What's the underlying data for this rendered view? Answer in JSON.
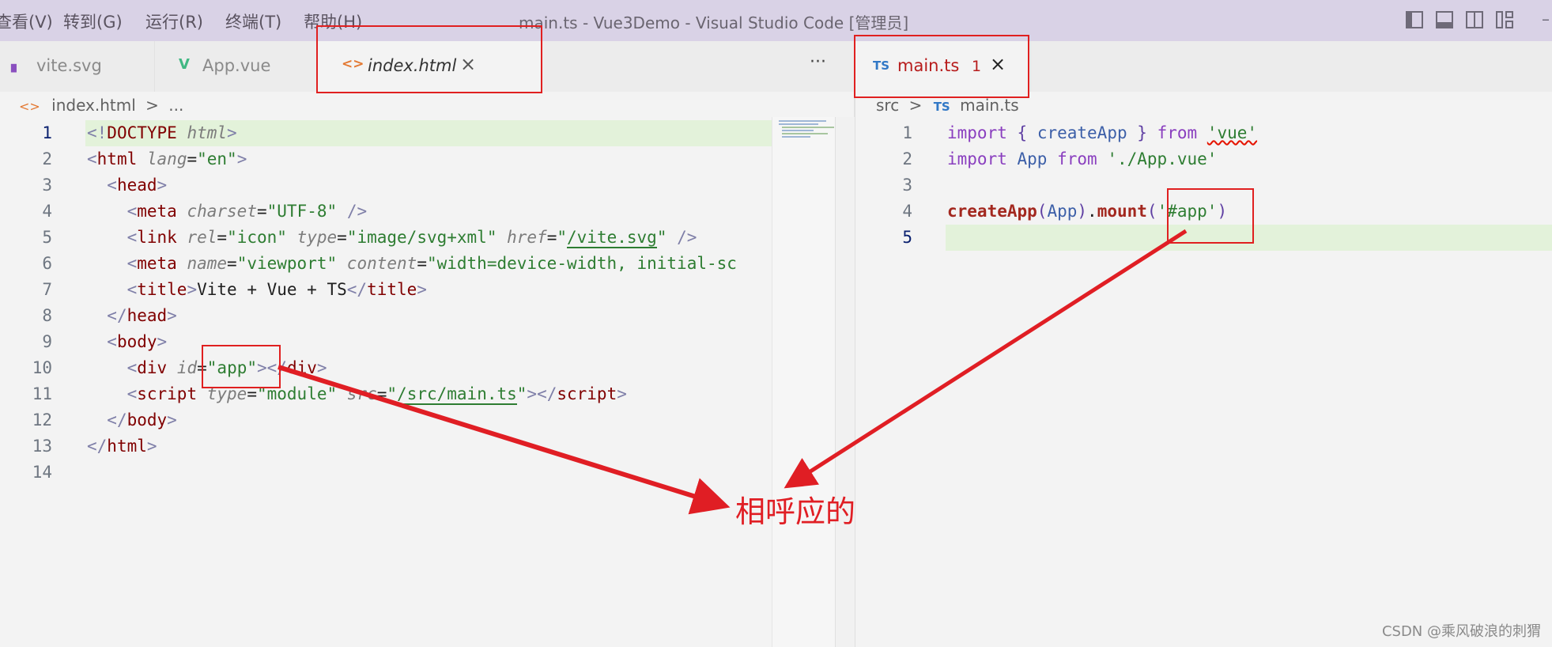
{
  "menubar": {
    "items": [
      "查看(V)",
      "转到(G)",
      "运行(R)",
      "终端(T)",
      "帮助(H)"
    ],
    "window_title": "main.ts - Vue3Demo - Visual Studio Code [管理员]"
  },
  "left_tabs": [
    {
      "icon": "▖",
      "label": "vite.svg"
    },
    {
      "icon": "V",
      "label": "App.vue"
    },
    {
      "icon": "<>",
      "label": "index.html",
      "close": "×"
    }
  ],
  "left_more": "···",
  "left_breadcrumb": {
    "icon": "<>",
    "file": "index.html",
    "sep": ">",
    "rest": "..."
  },
  "html_lines": [
    {
      "n": "1",
      "parts": [
        [
          "t-br",
          "<!"
        ],
        [
          "t-tag",
          "DOCTYPE"
        ],
        [
          "t-txt",
          " "
        ],
        [
          "t-attr",
          "html"
        ],
        [
          "t-br",
          ">"
        ]
      ]
    },
    {
      "n": "2",
      "parts": [
        [
          "t-br",
          "<"
        ],
        [
          "t-tag",
          "html"
        ],
        [
          "t-txt",
          " "
        ],
        [
          "t-attr",
          "lang"
        ],
        [
          "t-txt",
          "="
        ],
        [
          "t-str",
          "\"en\""
        ],
        [
          "t-br",
          ">"
        ]
      ]
    },
    {
      "n": "3",
      "parts": [
        [
          "t-txt",
          "  "
        ],
        [
          "t-br",
          "<"
        ],
        [
          "t-tag",
          "head"
        ],
        [
          "t-br",
          ">"
        ]
      ]
    },
    {
      "n": "4",
      "parts": [
        [
          "t-txt",
          "    "
        ],
        [
          "t-br",
          "<"
        ],
        [
          "t-tag",
          "meta"
        ],
        [
          "t-txt",
          " "
        ],
        [
          "t-attr",
          "charset"
        ],
        [
          "t-txt",
          "="
        ],
        [
          "t-str",
          "\"UTF-8\""
        ],
        [
          "t-txt",
          " "
        ],
        [
          "t-br",
          "/>"
        ]
      ]
    },
    {
      "n": "5",
      "parts": [
        [
          "t-txt",
          "    "
        ],
        [
          "t-br",
          "<"
        ],
        [
          "t-tag",
          "link"
        ],
        [
          "t-txt",
          " "
        ],
        [
          "t-attr",
          "rel"
        ],
        [
          "t-txt",
          "="
        ],
        [
          "t-str",
          "\"icon\""
        ],
        [
          "t-txt",
          " "
        ],
        [
          "t-attr",
          "type"
        ],
        [
          "t-txt",
          "="
        ],
        [
          "t-str",
          "\"image/svg+xml\""
        ],
        [
          "t-txt",
          " "
        ],
        [
          "t-attr",
          "href"
        ],
        [
          "t-txt",
          "="
        ],
        [
          "t-str",
          "\""
        ],
        [
          "t-str u",
          "/vite.svg"
        ],
        [
          "t-str",
          "\""
        ],
        [
          "t-txt",
          " "
        ],
        [
          "t-br",
          "/>"
        ]
      ]
    },
    {
      "n": "6",
      "parts": [
        [
          "t-txt",
          "    "
        ],
        [
          "t-br",
          "<"
        ],
        [
          "t-tag",
          "meta"
        ],
        [
          "t-txt",
          " "
        ],
        [
          "t-attr",
          "name"
        ],
        [
          "t-txt",
          "="
        ],
        [
          "t-str",
          "\"viewport\""
        ],
        [
          "t-txt",
          " "
        ],
        [
          "t-attr",
          "content"
        ],
        [
          "t-txt",
          "="
        ],
        [
          "t-str",
          "\"width=device-width, initial-sc"
        ]
      ]
    },
    {
      "n": "7",
      "parts": [
        [
          "t-txt",
          "    "
        ],
        [
          "t-br",
          "<"
        ],
        [
          "t-tag",
          "title"
        ],
        [
          "t-br",
          ">"
        ],
        [
          "t-txt",
          "Vite + Vue + TS"
        ],
        [
          "t-br",
          "</"
        ],
        [
          "t-tag",
          "title"
        ],
        [
          "t-br",
          ">"
        ]
      ]
    },
    {
      "n": "8",
      "parts": [
        [
          "t-txt",
          "  "
        ],
        [
          "t-br",
          "</"
        ],
        [
          "t-tag",
          "head"
        ],
        [
          "t-br",
          ">"
        ]
      ]
    },
    {
      "n": "9",
      "parts": [
        [
          "t-txt",
          "  "
        ],
        [
          "t-br",
          "<"
        ],
        [
          "t-tag",
          "body"
        ],
        [
          "t-br",
          ">"
        ]
      ]
    },
    {
      "n": "10",
      "parts": [
        [
          "t-txt",
          "    "
        ],
        [
          "t-br",
          "<"
        ],
        [
          "t-tag",
          "div"
        ],
        [
          "t-txt",
          " "
        ],
        [
          "t-attr",
          "id"
        ],
        [
          "t-txt",
          "="
        ],
        [
          "t-str",
          "\"app\""
        ],
        [
          "t-br",
          ">"
        ],
        [
          "t-br",
          "</"
        ],
        [
          "t-tag",
          "div"
        ],
        [
          "t-br",
          ">"
        ]
      ]
    },
    {
      "n": "11",
      "parts": [
        [
          "t-txt",
          "    "
        ],
        [
          "t-br",
          "<"
        ],
        [
          "t-tag",
          "script"
        ],
        [
          "t-txt",
          " "
        ],
        [
          "t-attr",
          "type"
        ],
        [
          "t-txt",
          "="
        ],
        [
          "t-str",
          "\"module\""
        ],
        [
          "t-txt",
          " "
        ],
        [
          "t-attr",
          "src"
        ],
        [
          "t-txt",
          "="
        ],
        [
          "t-str",
          "\""
        ],
        [
          "t-str u",
          "/src/main.ts"
        ],
        [
          "t-str",
          "\""
        ],
        [
          "t-br",
          "></"
        ],
        [
          "t-tag",
          "script"
        ],
        [
          "t-br",
          ">"
        ]
      ]
    },
    {
      "n": "12",
      "parts": [
        [
          "t-txt",
          "  "
        ],
        [
          "t-br",
          "</"
        ],
        [
          "t-tag",
          "body"
        ],
        [
          "t-br",
          ">"
        ]
      ]
    },
    {
      "n": "13",
      "parts": [
        [
          "t-br",
          "</"
        ],
        [
          "t-tag",
          "html"
        ],
        [
          "t-br",
          ">"
        ]
      ]
    },
    {
      "n": "14",
      "parts": []
    }
  ],
  "right_tab": {
    "icon": "TS",
    "label": "main.ts",
    "badge": "1",
    "close": "×"
  },
  "right_breadcrumb": {
    "folder": "src",
    "sep": ">",
    "icon": "TS",
    "file": "main.ts"
  },
  "ts_lines": [
    {
      "n": "1",
      "parts": [
        [
          "t-kw",
          "import"
        ],
        [
          "t-txt",
          " "
        ],
        [
          "t-punc",
          "{"
        ],
        [
          "t-txt",
          " "
        ],
        [
          "t-id",
          "createApp"
        ],
        [
          "t-txt",
          " "
        ],
        [
          "t-punc",
          "}"
        ],
        [
          "t-txt",
          " "
        ],
        [
          "t-kw",
          "from"
        ],
        [
          "t-txt",
          " "
        ],
        [
          "t-str sq",
          "'vue'"
        ]
      ]
    },
    {
      "n": "2",
      "parts": [
        [
          "t-kw",
          "import"
        ],
        [
          "t-txt",
          " "
        ],
        [
          "t-id",
          "App"
        ],
        [
          "t-txt",
          " "
        ],
        [
          "t-kw",
          "from"
        ],
        [
          "t-txt",
          " "
        ],
        [
          "t-str",
          "'./App.vue'"
        ]
      ]
    },
    {
      "n": "3",
      "parts": []
    },
    {
      "n": "4",
      "parts": [
        [
          "t-fn",
          "createApp"
        ],
        [
          "t-punc",
          "("
        ],
        [
          "t-id",
          "App"
        ],
        [
          "t-punc",
          ")"
        ],
        [
          "t-txt",
          "."
        ],
        [
          "t-fn",
          "mount"
        ],
        [
          "t-punc",
          "("
        ],
        [
          "t-str",
          "'#app'"
        ],
        [
          "t-punc",
          ")"
        ]
      ]
    },
    {
      "n": "5",
      "parts": []
    }
  ],
  "annotation": {
    "text": "相呼应的"
  },
  "watermark": "CSDN @乘风破浪的刺猬",
  "colors": {
    "annotation_red": "#e01e24",
    "menubar_bg": "#d9d2e6",
    "current_line": "#e3f2da"
  }
}
